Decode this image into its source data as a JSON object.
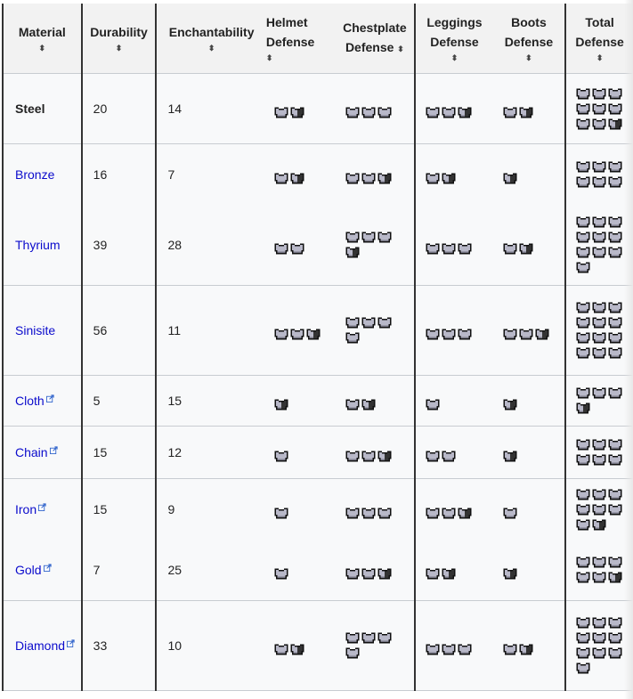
{
  "table": {
    "headers": {
      "material": "Material",
      "durability": "Durability",
      "enchantability": "Enchantability",
      "helmet_1": "Helmet",
      "helmet_2": "Defense",
      "chest_1": "Chestplate",
      "chest_2": "Defense",
      "legs_1": "Leggings",
      "legs_2": "Defense",
      "boots_1": "Boots",
      "boots_2": "Defense",
      "total_1": "Total",
      "total_2": "Defense",
      "sort_icon": "⬍"
    },
    "icon_legend": {
      "full_icon": "chestplate-full-icon (2 points)",
      "half_icon": "chestplate-half-icon (1 point)"
    },
    "colors": {
      "link": "#0b0bcc",
      "icon_light": "#b8b8c8",
      "icon_dark": "#333333",
      "border": "#333333",
      "row_divider": "#c8ccd1"
    },
    "rows": [
      {
        "material": "Steel",
        "link": false,
        "external": false,
        "durability": "20",
        "enchantability": "14",
        "helmet": 3,
        "chestplate": 6,
        "leggings": 5,
        "boots": 3,
        "total": 17
      },
      {
        "material": "Bronze",
        "link": true,
        "external": false,
        "durability": "16",
        "enchantability": "7",
        "helmet": 3,
        "chestplate": 5,
        "leggings": 3,
        "boots": 1,
        "total": 12
      },
      {
        "material": "Thyrium",
        "link": true,
        "external": false,
        "durability": "39",
        "enchantability": "28",
        "helmet": 4,
        "chestplate": 7,
        "leggings": 6,
        "boots": 3,
        "total": 20
      },
      {
        "material": "Sinisite",
        "link": true,
        "external": false,
        "durability": "56",
        "enchantability": "11",
        "helmet": 5,
        "chestplate": 8,
        "leggings": 6,
        "boots": 5,
        "total": 24
      },
      {
        "material": "Cloth",
        "link": true,
        "external": true,
        "durability": "5",
        "enchantability": "15",
        "helmet": 1,
        "chestplate": 3,
        "leggings": 2,
        "boots": 1,
        "total": 7
      },
      {
        "material": "Chain",
        "link": true,
        "external": true,
        "durability": "15",
        "enchantability": "12",
        "helmet": 2,
        "chestplate": 5,
        "leggings": 4,
        "boots": 1,
        "total": 12
      },
      {
        "material": "Iron",
        "link": true,
        "external": true,
        "durability": "15",
        "enchantability": "9",
        "helmet": 2,
        "chestplate": 6,
        "leggings": 5,
        "boots": 2,
        "total": 15
      },
      {
        "material": "Gold",
        "link": true,
        "external": true,
        "durability": "7",
        "enchantability": "25",
        "helmet": 2,
        "chestplate": 5,
        "leggings": 3,
        "boots": 1,
        "total": 11
      },
      {
        "material": "Diamond",
        "link": true,
        "external": true,
        "durability": "33",
        "enchantability": "10",
        "helmet": 3,
        "chestplate": 8,
        "leggings": 6,
        "boots": 3,
        "total": 20
      }
    ]
  }
}
